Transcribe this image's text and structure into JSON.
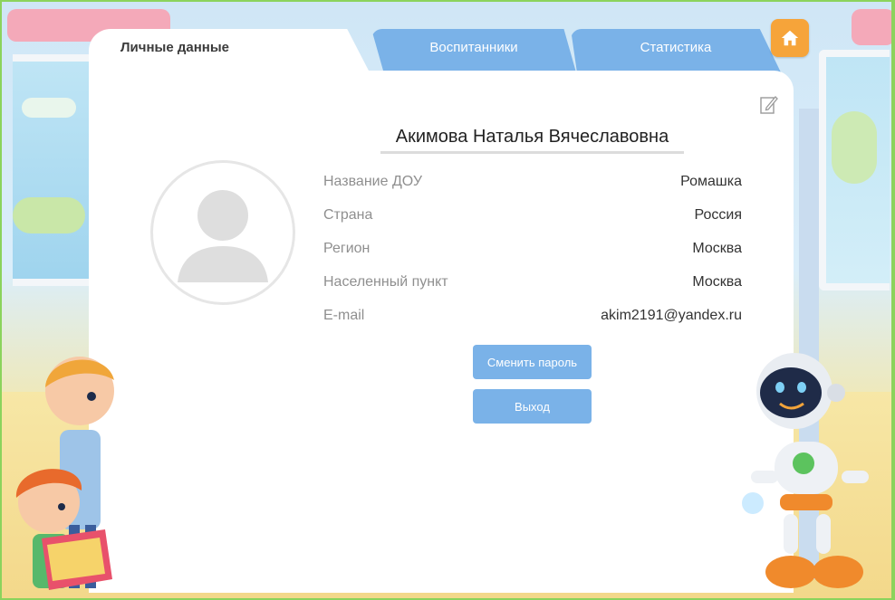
{
  "tabs": [
    {
      "label": "Личные данные",
      "active": true
    },
    {
      "label": "Воспитанники",
      "active": false
    },
    {
      "label": "Статистика",
      "active": false
    }
  ],
  "icons": {
    "home": "home-icon",
    "edit": "edit-icon",
    "avatar": "user-avatar-placeholder"
  },
  "profile": {
    "full_name": "Акимова Наталья Вячеславовна",
    "fields": [
      {
        "label": "Название ДОУ",
        "value": "Ромашка"
      },
      {
        "label": "Страна",
        "value": "Россия"
      },
      {
        "label": "Регион",
        "value": "Москва"
      },
      {
        "label": "Населенный пункт",
        "value": "Москва"
      },
      {
        "label": "E-mail",
        "value": "akim2191@yandex.ru"
      }
    ]
  },
  "actions": {
    "change_password": "Сменить пароль",
    "logout": "Выход"
  },
  "colors": {
    "tab_inactive": "#7ab2e8",
    "button": "#7ab2e8",
    "home_button": "#f6a43a",
    "frame": "#8bd35c"
  }
}
